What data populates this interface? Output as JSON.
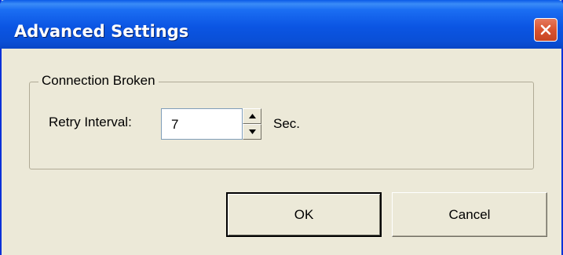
{
  "window": {
    "title": "Advanced Settings",
    "close_icon": "close-icon"
  },
  "group": {
    "title": "Connection Broken",
    "retry_label": "Retry Interval:",
    "retry_value": "7",
    "unit": "Sec.",
    "up_icon": "arrow-up-icon",
    "down_icon": "arrow-down-icon"
  },
  "buttons": {
    "ok": "OK",
    "cancel": "Cancel"
  },
  "colors": {
    "titlebar": "#0a5ae8",
    "close": "#d9532f",
    "face": "#ece9d8"
  }
}
